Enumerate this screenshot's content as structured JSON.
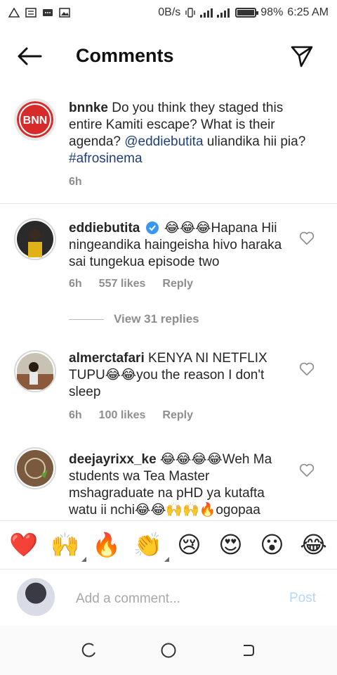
{
  "status_bar": {
    "network_speed": "0B/s",
    "battery_percent": "98%",
    "battery_level": 0.98,
    "time": "6:25 AM",
    "icons": [
      "warning-icon",
      "news-icon",
      "message-icon",
      "image-icon",
      "vibrate-icon",
      "signal-icon",
      "battery-icon"
    ]
  },
  "header": {
    "title": "Comments",
    "back_icon": "arrow-left-icon",
    "send_icon": "paper-plane-icon"
  },
  "caption": {
    "username": "bnnke",
    "avatar_text": "BNN",
    "text_before": "Do you think they staged this entire Kamiti escape? What is their agenda?",
    "mention": "@eddiebutita",
    "text_middle": "uliandika hii pia?",
    "hashtag": "#afrosinema",
    "time": "6h"
  },
  "comments": [
    {
      "username": "eddiebutita",
      "verified": true,
      "text": "😂😂😂Hapana Hii ningeandika haingeisha hivo haraka sai tungekua episode two",
      "time": "6h",
      "likes": "557 likes",
      "reply": "Reply"
    },
    {
      "username": "almerctafari",
      "text": "KENYA NI NETFLIX TUPU😂😂you the reason I don't sleep",
      "time": "6h",
      "likes": "100 likes",
      "reply": "Reply"
    },
    {
      "username": "deejayrixx_ke",
      "text": "😂😂😂😂Weh Ma students wa Tea Master mshagraduate na pHD ya kutafta watu ii nchi😂😂🙌🙌🔥ogopaa"
    }
  ],
  "view_replies": "View 31 replies",
  "emoji_bar": [
    "❤️",
    "🙌",
    "🔥",
    "👏",
    "😢",
    "😍",
    "😮",
    "😂"
  ],
  "add_comment": {
    "placeholder": "Add a comment...",
    "post_label": "Post"
  },
  "colors": {
    "link": "#1f3f7a",
    "post_disabled": "#b3d7f6",
    "meta_gray": "#8e8e8e",
    "brand_red": "#d72b2b"
  }
}
